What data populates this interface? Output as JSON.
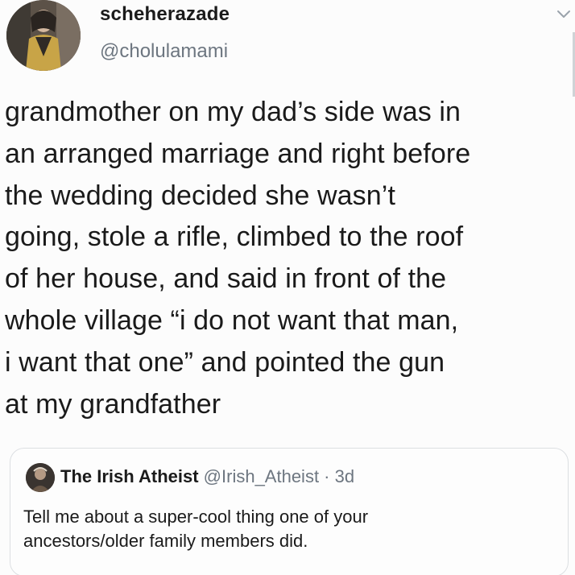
{
  "tweet": {
    "display_name": "scheherazade",
    "handle": "@cholulamami",
    "text": "grandmother on my dad’s side was in\nan arranged marriage and right before\nthe wedding decided she wasn’t\ngoing, stole a rifle, climbed to the roof\nof her house, and said in front of the\nwhole village “i do not want that man,\ni want that one” and pointed the gun\nat my grandfather",
    "menu_icon": "chevron-down-icon"
  },
  "quoted_tweet": {
    "display_name": "The Irish Atheist",
    "handle": "@Irish_Atheist",
    "separator": " · ",
    "time": "3d",
    "text": "Tell me about a super-cool thing one of your\nancestors/older family members did."
  },
  "colors": {
    "text": "#1a1a1a",
    "muted": "#6d7680",
    "border": "#dcdfe2"
  }
}
